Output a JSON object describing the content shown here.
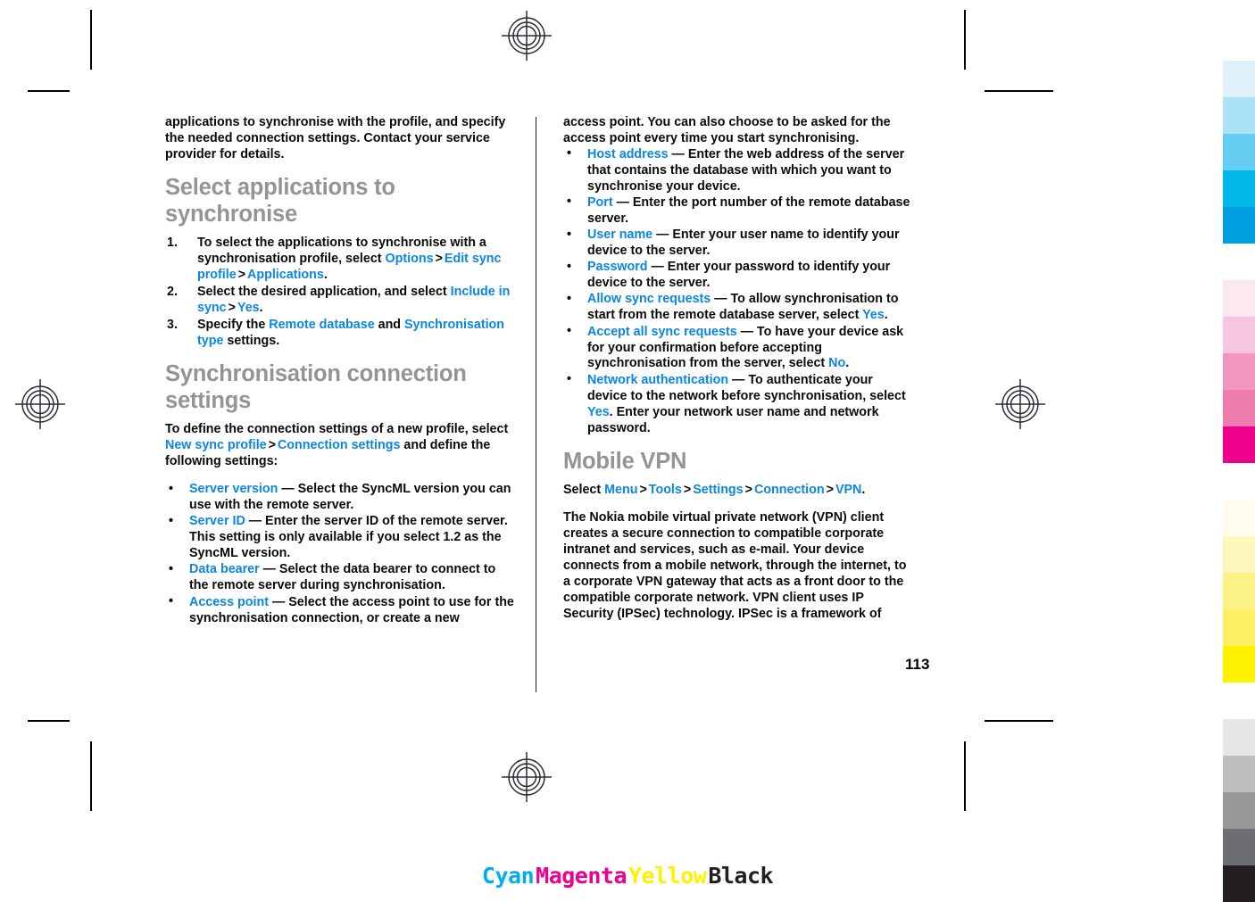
{
  "page": {
    "number": "113",
    "link_color": "#0a86e4",
    "heading_color": "#949494",
    "text_color": "#0a0a0a"
  },
  "left_column": {
    "intro_paragraph": "applications to synchronise with the profile, and specify the needed connection settings. Contact your service provider for details.",
    "section1": {
      "heading": "Select applications to synchronise",
      "steps": [
        {
          "num": "1.",
          "parts": [
            {
              "t": "To select the applications to synchronise with a synchronisation profile, select ",
              "s": "plain"
            },
            {
              "t": "Options",
              "s": "link"
            },
            {
              "t": ">",
              "s": "gt"
            },
            {
              "t": "Edit sync profile",
              "s": "link"
            },
            {
              "t": ">",
              "s": "gt"
            },
            {
              "t": "Applications",
              "s": "link"
            },
            {
              "t": ".",
              "s": "plain"
            }
          ]
        },
        {
          "num": "2.",
          "parts": [
            {
              "t": "Select the desired application, and select ",
              "s": "plain"
            },
            {
              "t": "Include in sync",
              "s": "link"
            },
            {
              "t": ">",
              "s": "gt"
            },
            {
              "t": "Yes",
              "s": "link"
            },
            {
              "t": ".",
              "s": "plain"
            }
          ]
        },
        {
          "num": "3.",
          "parts": [
            {
              "t": "Specify the ",
              "s": "plain"
            },
            {
              "t": "Remote database",
              "s": "link"
            },
            {
              "t": " and ",
              "s": "plain"
            },
            {
              "t": "Synchronisation type",
              "s": "link"
            },
            {
              "t": " settings.",
              "s": "plain"
            }
          ]
        }
      ]
    },
    "section2": {
      "heading": "Synchronisation connection settings",
      "intro": [
        {
          "t": "To define the connection settings of a new profile, select ",
          "s": "plain"
        },
        {
          "t": "New sync profile",
          "s": "link"
        },
        {
          "t": ">",
          "s": "gt"
        },
        {
          "t": "Connection settings",
          "s": "link"
        },
        {
          "t": " and define the following settings:",
          "s": "plain"
        }
      ],
      "bullets": [
        [
          {
            "t": "Server version",
            "s": "link"
          },
          {
            "t": " — Select the SyncML version you can use with the remote server.",
            "s": "plain"
          }
        ],
        [
          {
            "t": "Server ID",
            "s": "link"
          },
          {
            "t": " — Enter the server ID of the remote server. This setting is only available if you select 1.2 as the SyncML version.",
            "s": "plain"
          }
        ],
        [
          {
            "t": "Data bearer",
            "s": "link"
          },
          {
            "t": " — Select the data bearer to connect to the remote server during synchronisation.",
            "s": "plain"
          }
        ],
        [
          {
            "t": "Access point",
            "s": "link"
          },
          {
            "t": " — Select the access point to use for the synchronisation connection, or create a new",
            "s": "plain"
          }
        ]
      ]
    }
  },
  "right_column": {
    "continued_paragraph": "access point. You can also choose to be asked for the access point every time you start synchronising.",
    "bullets": [
      [
        {
          "t": "Host address",
          "s": "link"
        },
        {
          "t": " — Enter the web address of the server that contains the database with which you want to synchronise your device.",
          "s": "plain"
        }
      ],
      [
        {
          "t": "Port",
          "s": "link"
        },
        {
          "t": " — Enter the port number of the remote database server.",
          "s": "plain"
        }
      ],
      [
        {
          "t": "User name",
          "s": "link"
        },
        {
          "t": " — Enter your user name to identify your device to the server.",
          "s": "plain"
        }
      ],
      [
        {
          "t": "Password",
          "s": "link"
        },
        {
          "t": " — Enter your password to identify your device to the server.",
          "s": "plain"
        }
      ],
      [
        {
          "t": "Allow sync requests",
          "s": "link"
        },
        {
          "t": " — To allow synchronisation to start from the remote database server, select ",
          "s": "plain"
        },
        {
          "t": "Yes",
          "s": "link"
        },
        {
          "t": ".",
          "s": "plain"
        }
      ],
      [
        {
          "t": "Accept all sync requests",
          "s": "link"
        },
        {
          "t": " — To have your device ask for your confirmation before accepting synchronisation from the server, select ",
          "s": "plain"
        },
        {
          "t": "No",
          "s": "link"
        },
        {
          "t": ".",
          "s": "plain"
        }
      ],
      [
        {
          "t": "Network authentication",
          "s": "link"
        },
        {
          "t": " — To authenticate your device to the network before synchronisation, select ",
          "s": "plain"
        },
        {
          "t": "Yes",
          "s": "link"
        },
        {
          "t": ". Enter your network user name and network password.",
          "s": "plain"
        }
      ]
    ],
    "section3": {
      "heading": "Mobile VPN",
      "path": [
        {
          "t": "Select ",
          "s": "plain"
        },
        {
          "t": "Menu",
          "s": "link"
        },
        {
          "t": ">",
          "s": "gt"
        },
        {
          "t": "Tools",
          "s": "link"
        },
        {
          "t": ">",
          "s": "gt"
        },
        {
          "t": "Settings",
          "s": "link"
        },
        {
          "t": ">",
          "s": "gt"
        },
        {
          "t": "Connection",
          "s": "link"
        },
        {
          "t": ">",
          "s": "gt"
        },
        {
          "t": "VPN",
          "s": "link"
        },
        {
          "t": ".",
          "s": "plain"
        }
      ],
      "paragraph": "The Nokia mobile virtual private network (VPN) client creates a secure connection to compatible corporate intranet and services, such as e-mail. Your device connects from a mobile network, through the internet, to a corporate VPN gateway that acts as a front door to the compatible corporate network. VPN client uses IP Security (IPSec) technology. IPSec is a framework of"
    }
  },
  "colour_strip": {
    "groups": [
      {
        "name": "cyan",
        "colors": [
          "#e1f1fb",
          "#ace2f8",
          "#66cdf2",
          "#00b7ea",
          "#00a0e0"
        ]
      },
      {
        "name": "magenta",
        "colors": [
          "#fbe8f1",
          "#f5c6dd",
          "#f096c0",
          "#ee7daf",
          "#ec008c"
        ]
      },
      {
        "name": "yellow",
        "colors": [
          "#fffced",
          "#fdf7bd",
          "#fbf287",
          "#fbef62",
          "#fff200"
        ]
      },
      {
        "name": "black",
        "colors": [
          "#e6e6e6",
          "#bcbec0",
          "#979899",
          "#6d6e71",
          "#231f20"
        ]
      }
    ]
  },
  "cmyk_legend": {
    "items": [
      {
        "label": "Cyan",
        "color": "#00aeef"
      },
      {
        "label": "Magenta",
        "color": "#ec008c"
      },
      {
        "label": "Yellow",
        "color": "#fff200"
      },
      {
        "label": "Black",
        "color": "#231f20"
      }
    ]
  }
}
